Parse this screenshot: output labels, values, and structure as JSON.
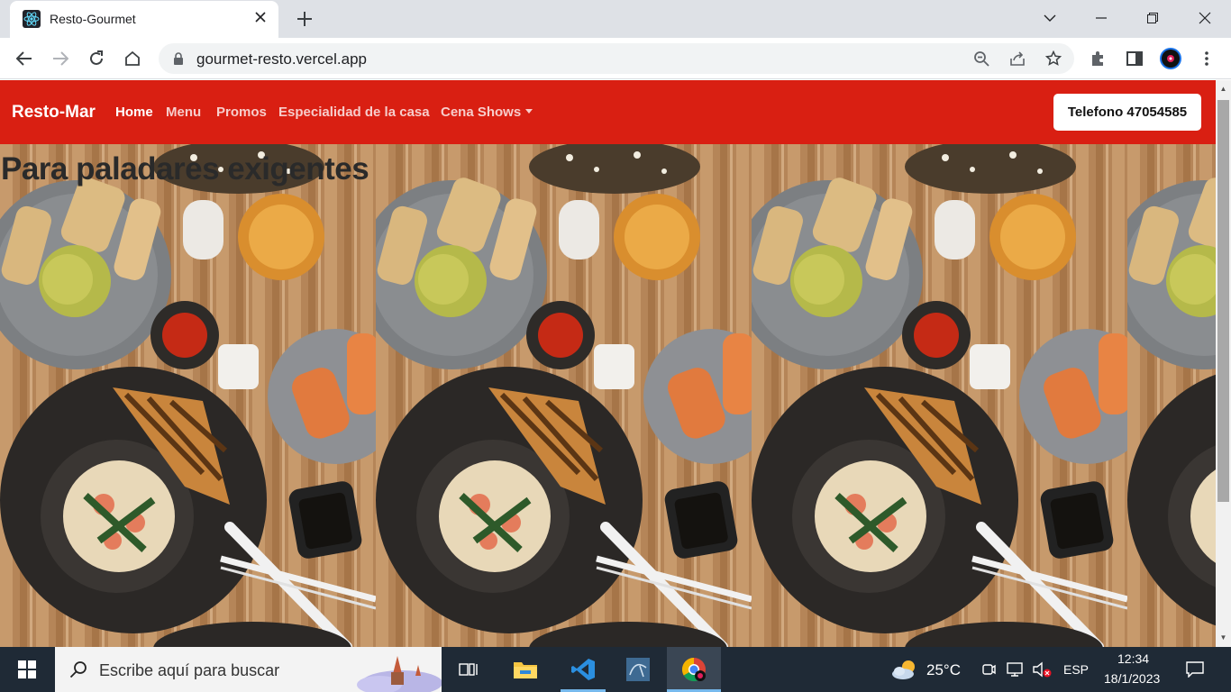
{
  "browser": {
    "tab_title": "Resto-Gourmet",
    "url": "gourmet-resto.vercel.app"
  },
  "site": {
    "brand": "Resto-Mar",
    "nav": [
      "Home",
      "Menu",
      "Promos",
      "Especialidad de la casa",
      "Cena Shows"
    ],
    "phone_button": "Telefono 47054585",
    "hero_title": "Para paladares exigentes"
  },
  "taskbar": {
    "search_placeholder": "Escribe aquí para buscar",
    "temperature": "25°C",
    "language": "ESP",
    "time": "12:34",
    "date": "18/1/2023"
  },
  "colors": {
    "navbar": "#d91f12",
    "taskbar": "#1f2a36"
  },
  "icons": [
    "react-favicon",
    "close-icon",
    "plus-icon",
    "chevron-down-icon",
    "minimize-icon",
    "maximize-icon",
    "window-close-icon",
    "back-icon",
    "forward-icon",
    "reload-icon",
    "home-icon",
    "lock-icon",
    "zoom-out-icon",
    "share-icon",
    "star-icon",
    "extensions-icon",
    "side-panel-icon",
    "profile-avatar",
    "kebab-menu-icon",
    "windows-start-icon",
    "search-icon",
    "task-view-icon",
    "file-explorer-icon",
    "vscode-icon",
    "mysql-icon",
    "chrome-icon",
    "weather-icon",
    "meet-icon",
    "network-icon",
    "volume-muted-icon",
    "notifications-icon"
  ]
}
